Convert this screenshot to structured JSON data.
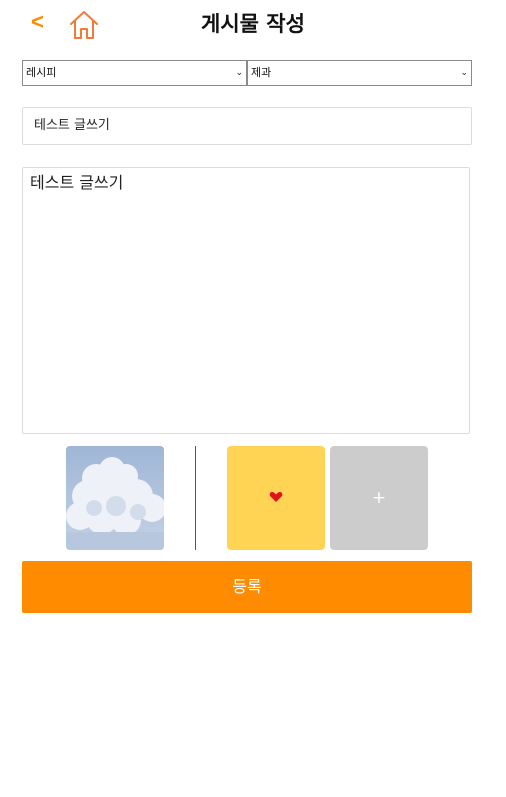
{
  "header": {
    "back_label": "<",
    "title": "게시물 작성"
  },
  "selects": {
    "category": "레시피",
    "subcategory": "제과"
  },
  "title_field": {
    "value": "테스트 글쓰기"
  },
  "content_field": {
    "value": "테스트 글쓰기"
  },
  "attachments": {
    "add_label": "+"
  },
  "submit": {
    "label": "등록"
  },
  "colors": {
    "accent": "#ff8c00",
    "tile_yellow": "#ffd455",
    "tile_gray": "#cccccc"
  },
  "icons": {
    "home": "home-icon",
    "heart": "heart-icon",
    "chevron": "chevron-down-icon"
  }
}
